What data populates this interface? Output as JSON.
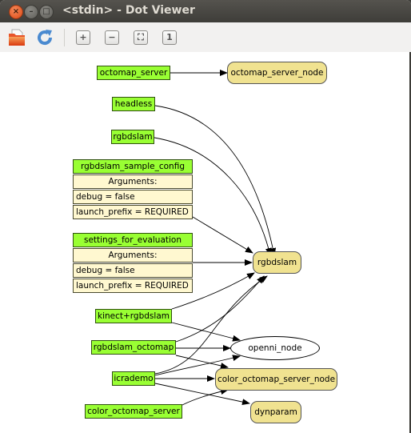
{
  "window": {
    "title": "<stdin> - Dot Viewer",
    "buttons": {
      "close": "×",
      "minimize": "–",
      "maximize": "□"
    }
  },
  "toolbar": {
    "open_icon": "folder-open-icon",
    "reload_icon": "refresh-icon",
    "zoom_in": "+",
    "zoom_out": "−",
    "zoom_fit": "⛶",
    "zoom_100": "1"
  },
  "graph": {
    "launch_nodes": [
      {
        "id": "octomap_server",
        "label": "octomap_server"
      },
      {
        "id": "headless",
        "label": "headless"
      },
      {
        "id": "rgbdslam_launch",
        "label": "rgbdslam"
      },
      {
        "id": "rgbdslam_sample_config",
        "label": "rgbdslam_sample_config",
        "arguments_header": "Arguments:",
        "arguments": [
          "debug = false",
          "launch_prefix = REQUIRED"
        ]
      },
      {
        "id": "settings_for_evaluation",
        "label": "settings_for_evaluation",
        "arguments_header": "Arguments:",
        "arguments": [
          "debug = false",
          "launch_prefix = REQUIRED"
        ]
      },
      {
        "id": "kinect_rgbdslam",
        "label": "kinect+rgbdslam"
      },
      {
        "id": "rgbdslam_octomap",
        "label": "rgbdslam_octomap"
      },
      {
        "id": "icrademo",
        "label": "icrademo"
      },
      {
        "id": "color_octomap_server",
        "label": "color_octomap_server"
      }
    ],
    "process_nodes": [
      {
        "id": "octomap_server_node",
        "label": "octomap_server_node"
      },
      {
        "id": "rgbdslam_node",
        "label": "rgbdslam"
      },
      {
        "id": "openni_node",
        "label": "openni_node"
      },
      {
        "id": "color_octomap_server_node",
        "label": "color_octomap_server_node"
      },
      {
        "id": "dynparam",
        "label": "dynparam"
      }
    ],
    "edges": [
      [
        "octomap_server",
        "octomap_server_node"
      ],
      [
        "headless",
        "rgbdslam_node"
      ],
      [
        "rgbdslam_launch",
        "rgbdslam_node"
      ],
      [
        "rgbdslam_sample_config",
        "rgbdslam_node"
      ],
      [
        "settings_for_evaluation",
        "rgbdslam_node"
      ],
      [
        "kinect_rgbdslam",
        "rgbdslam_node"
      ],
      [
        "kinect_rgbdslam",
        "openni_node"
      ],
      [
        "rgbdslam_octomap",
        "rgbdslam_node"
      ],
      [
        "rgbdslam_octomap",
        "openni_node"
      ],
      [
        "rgbdslam_octomap",
        "color_octomap_server_node"
      ],
      [
        "icrademo",
        "rgbdslam_node"
      ],
      [
        "icrademo",
        "openni_node"
      ],
      [
        "icrademo",
        "color_octomap_server_node"
      ],
      [
        "icrademo",
        "dynparam"
      ],
      [
        "color_octomap_server",
        "color_octomap_server_node"
      ]
    ]
  }
}
